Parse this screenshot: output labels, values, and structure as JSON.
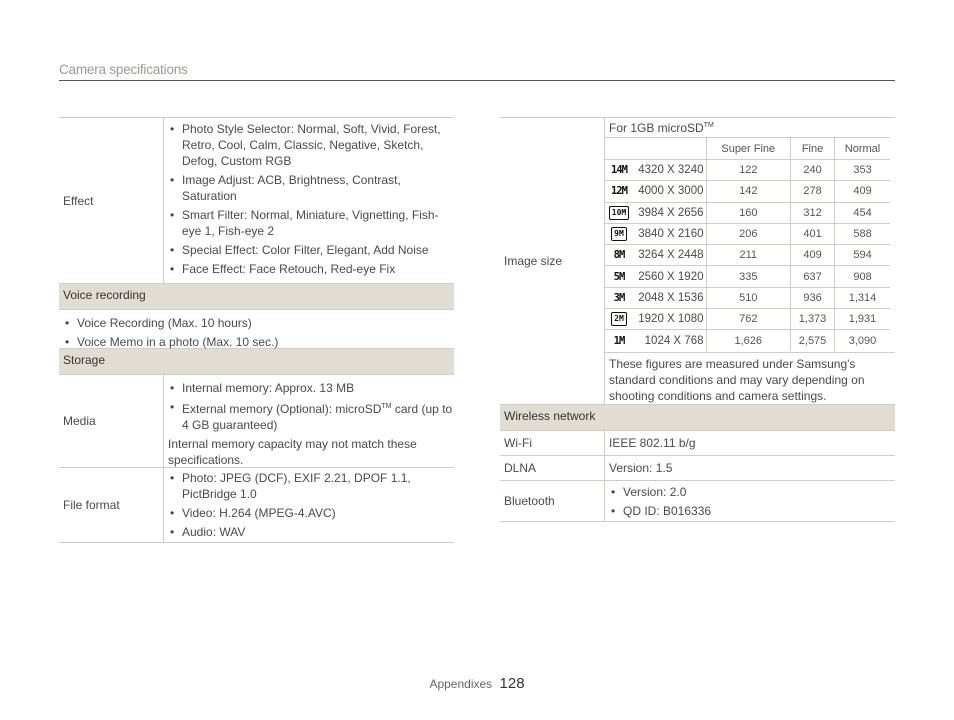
{
  "header": {
    "title": "Camera specifications"
  },
  "left": {
    "effect": {
      "label": "Effect",
      "items": [
        "Photo Style Selector: Normal, Soft, Vivid, Forest, Retro, Cool, Calm, Classic, Negative, Sketch, Defog, Custom RGB",
        "Image Adjust: ACB, Brightness, Contrast, Saturation",
        "Smart Filter: Normal, Miniature, Vignetting, Fish-eye 1, Fish-eye 2",
        "Special Effect: Color Filter, Elegant, Add Noise",
        "Face Effect: Face Retouch, Red-eye Fix"
      ]
    },
    "voice": {
      "title": "Voice recording",
      "items": [
        "Voice Recording (Max. 10 hours)",
        "Voice Memo in a photo (Max. 10 sec.)"
      ]
    },
    "storage": {
      "title": "Storage",
      "media_label": "Media",
      "media_item1": "Internal memory: Approx. 13 MB",
      "media_item2_pre": "External memory (Optional): microSD",
      "media_item2_tm": "TM",
      "media_item2_post": " card (up to 4 GB guaranteed)",
      "media_note": "Internal memory capacity may not match these specifications.",
      "format_label": "File format",
      "format_items": [
        "Photo: JPEG (DCF), EXIF 2.21, DPOF 1.1, PictBridge 1.0",
        "Video: H.264 (MPEG-4.AVC)",
        "Audio: WAV"
      ]
    }
  },
  "right": {
    "image_size": {
      "label": "Image size",
      "title_pre": "For 1GB microSD",
      "title_tm": "TM",
      "headers": [
        "Super Fine",
        "Fine",
        "Normal"
      ],
      "rows": [
        {
          "icon": "14M",
          "res": "4320 X 3240",
          "sf": "122",
          "f": "240",
          "n": "353"
        },
        {
          "icon": "12M",
          "res": "4000 X 3000",
          "sf": "142",
          "f": "278",
          "n": "409"
        },
        {
          "icon": "10M",
          "res": "3984 X 2656",
          "sf": "160",
          "f": "312",
          "n": "454"
        },
        {
          "icon": "9M",
          "res": "3840 X 2160",
          "sf": "206",
          "f": "401",
          "n": "588"
        },
        {
          "icon": "8M",
          "res": "3264 X 2448",
          "sf": "211",
          "f": "409",
          "n": "594"
        },
        {
          "icon": "5M",
          "res": "2560 X 1920",
          "sf": "335",
          "f": "637",
          "n": "908"
        },
        {
          "icon": "3M",
          "res": "2048 X 1536",
          "sf": "510",
          "f": "936",
          "n": "1,314"
        },
        {
          "icon": "2M",
          "res": "1920 X 1080",
          "sf": "762",
          "f": "1,373",
          "n": "1,931"
        },
        {
          "icon": "1M",
          "res": "1024 X 768",
          "sf": "1,626",
          "f": "2,575",
          "n": "3,090"
        }
      ],
      "note": "These figures are measured under Samsung's standard conditions and may vary depending on shooting conditions and camera settings."
    },
    "wireless": {
      "title": "Wireless network",
      "wifi_label": "Wi-Fi",
      "wifi_value": "IEEE 802.11 b/g",
      "dlna_label": "DLNA",
      "dlna_value": "Version: 1.5",
      "bt_label": "Bluetooth",
      "bt_items": [
        "Version: 2.0",
        "QD ID: B016336"
      ]
    }
  },
  "footer": {
    "label": "Appendixes",
    "page": "128"
  }
}
